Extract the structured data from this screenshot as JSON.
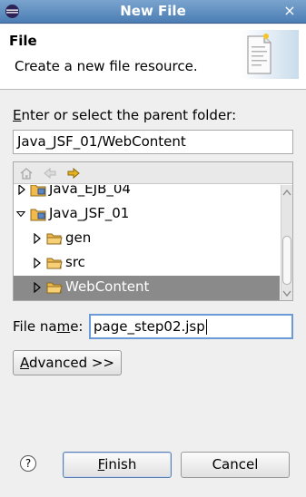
{
  "window": {
    "title": "New File",
    "close_glyph": "×"
  },
  "header": {
    "title": "File",
    "description": "Create a new file resource."
  },
  "parent_folder": {
    "label_mnemonic": "E",
    "label_rest": "nter or select the parent folder:",
    "value": "Java_JSF_01/WebContent"
  },
  "tree": {
    "items": [
      {
        "label": "Java_EJB_04",
        "expanded": false
      },
      {
        "label": "Java_JSF_01",
        "expanded": true
      },
      {
        "label": "gen",
        "expanded": false
      },
      {
        "label": "src",
        "expanded": false
      },
      {
        "label": "WebContent",
        "expanded": false,
        "selected": true
      }
    ]
  },
  "file_name": {
    "label_prefix": "File na",
    "label_mnemonic": "m",
    "label_suffix": "e:",
    "value": "page_step02.jsp"
  },
  "buttons": {
    "advanced_mnemonic": "A",
    "advanced_rest": "dvanced >>",
    "finish_mnemonic": "F",
    "finish_rest": "inish",
    "cancel": "Cancel",
    "help_glyph": "?"
  },
  "colors": {
    "title_bar": "#4b7db3",
    "selection": "#8a8a8a",
    "folder": "#f2b94b",
    "nav_arrow": "#e8b21e"
  },
  "icons": {
    "window": "eclipse-icon",
    "header": "new-file-wizard-icon",
    "home": "home-icon",
    "back": "back-arrow-icon",
    "forward": "forward-arrow-icon",
    "project": "project-icon",
    "folder": "folder-icon",
    "help": "help-icon"
  }
}
